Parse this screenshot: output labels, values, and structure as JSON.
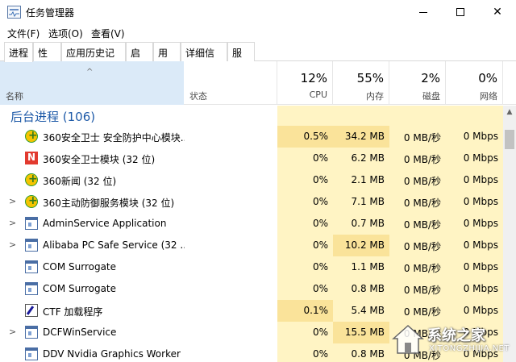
{
  "window": {
    "title": "任务管理器"
  },
  "menu": [
    "文件(F)",
    "选项(O)",
    "查看(V)"
  ],
  "tabs": [
    "进程",
    "性能",
    "应用历史记录",
    "启动",
    "用户",
    "详细信息",
    "服务"
  ],
  "columns": {
    "name": "名称",
    "status": "状态",
    "cpu": {
      "pct": "12%",
      "label": "CPU"
    },
    "mem": {
      "pct": "55%",
      "label": "内存"
    },
    "disk": {
      "pct": "2%",
      "label": "磁盘"
    },
    "net": {
      "pct": "0%",
      "label": "网络"
    }
  },
  "group": {
    "title": "后台进程 (106)"
  },
  "rows": [
    {
      "name": "360安全卫士 安全防护中心模块...",
      "icon": "360-shield-icon",
      "expand": false,
      "cpu": "0.5%",
      "mem": "34.2 MB",
      "disk": "0 MB/秒",
      "net": "0 Mbps"
    },
    {
      "name": "360安全卫士模块 (32 位)",
      "icon": "360-red-icon",
      "expand": false,
      "cpu": "0%",
      "mem": "6.2 MB",
      "disk": "0 MB/秒",
      "net": "0 Mbps"
    },
    {
      "name": "360新闻 (32 位)",
      "icon": "360-shield-icon",
      "expand": false,
      "cpu": "0%",
      "mem": "2.1 MB",
      "disk": "0 MB/秒",
      "net": "0 Mbps"
    },
    {
      "name": "360主动防御服务模块 (32 位)",
      "icon": "360-shield-icon",
      "expand": true,
      "cpu": "0%",
      "mem": "7.1 MB",
      "disk": "0 MB/秒",
      "net": "0 Mbps"
    },
    {
      "name": "AdminService Application",
      "icon": "window-icon",
      "expand": true,
      "cpu": "0%",
      "mem": "0.7 MB",
      "disk": "0 MB/秒",
      "net": "0 Mbps"
    },
    {
      "name": "Alibaba PC Safe Service (32 ...",
      "icon": "window-icon",
      "expand": true,
      "cpu": "0%",
      "mem": "10.2 MB",
      "disk": "0 MB/秒",
      "net": "0 Mbps"
    },
    {
      "name": "COM Surrogate",
      "icon": "window-icon",
      "expand": false,
      "cpu": "0%",
      "mem": "1.1 MB",
      "disk": "0 MB/秒",
      "net": "0 Mbps"
    },
    {
      "name": "COM Surrogate",
      "icon": "window-icon",
      "expand": false,
      "cpu": "0%",
      "mem": "0.8 MB",
      "disk": "0 MB/秒",
      "net": "0 Mbps"
    },
    {
      "name": "CTF 加载程序",
      "icon": "ctf-loader-icon",
      "expand": false,
      "cpu": "0.1%",
      "mem": "5.4 MB",
      "disk": "0 MB/秒",
      "net": "0 Mbps"
    },
    {
      "name": "DCFWinService",
      "icon": "window-icon",
      "expand": true,
      "cpu": "0%",
      "mem": "15.5 MB",
      "disk": "0 MB/秒",
      "net": "0 Mbps"
    },
    {
      "name": "DDV Nvidia Graphics Worker",
      "icon": "window-icon",
      "expand": false,
      "cpu": "0%",
      "mem": "0.8 MB",
      "disk": "0 MB/秒",
      "net": "0 Mbps"
    }
  ],
  "watermark": {
    "text": "系统之家",
    "url": "XITONGZHIJIA.NET"
  },
  "colors": {
    "heat_light": "#fff4c4",
    "heat_mid": "#fae39a",
    "header_selected": "#dbeaf8",
    "group_title": "#1e5aa8"
  }
}
